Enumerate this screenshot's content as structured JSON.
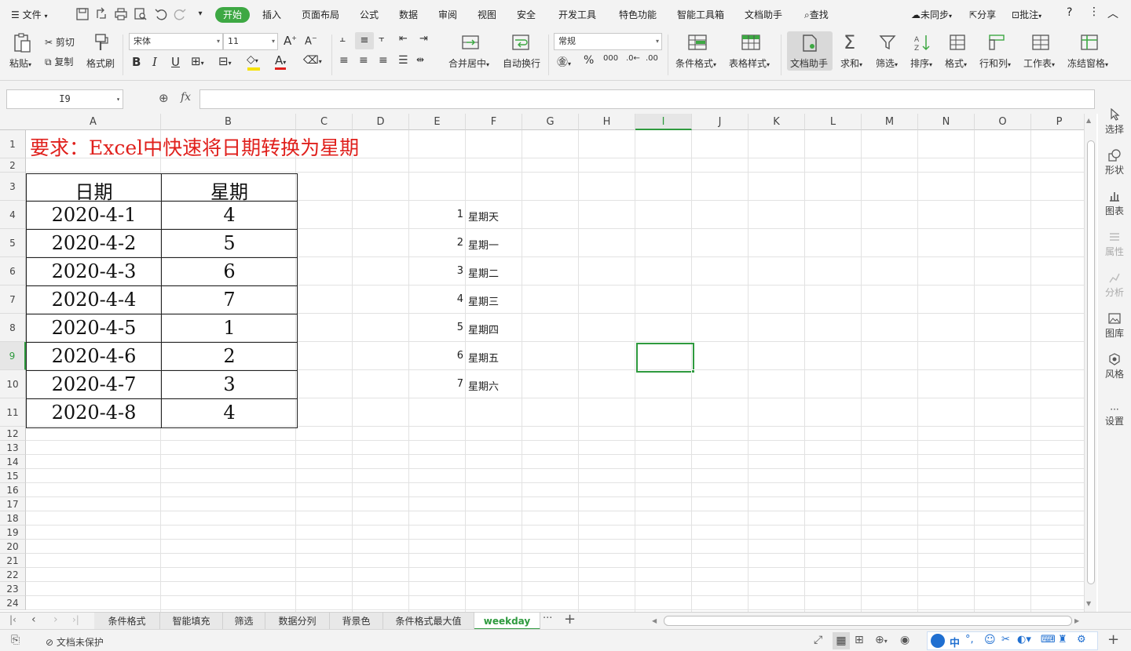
{
  "menubar": {
    "file": "文件",
    "tabs": [
      "开始",
      "插入",
      "页面布局",
      "公式",
      "数据",
      "审阅",
      "视图",
      "安全",
      "开发工具",
      "特色功能",
      "智能工具箱",
      "文档助手"
    ],
    "search": "查找",
    "sync": "未同步",
    "share": "分享",
    "review": "批注"
  },
  "ribbon": {
    "paste": "粘贴",
    "cut": "剪切",
    "copy": "复制",
    "format_painter": "格式刷",
    "font_name": "宋体",
    "font_size": "11",
    "merge_center": "合并居中",
    "wrap_text": "自动换行",
    "number_format": "常规",
    "cond_format": "条件格式",
    "table_style": "表格样式",
    "doc_helper": "文档助手",
    "sum": "求和",
    "filter": "筛选",
    "sort": "排序",
    "format": "格式",
    "row_col": "行和列",
    "worksheet": "工作表",
    "freeze": "冻结窗格"
  },
  "formula_bar": {
    "name_box": "I9",
    "fx": "fx",
    "value": ""
  },
  "columns": [
    "A",
    "B",
    "C",
    "D",
    "E",
    "F",
    "G",
    "H",
    "I",
    "J",
    "K",
    "L",
    "M",
    "N",
    "O",
    "P"
  ],
  "rows": [
    "1",
    "2",
    "3",
    "4",
    "5",
    "6",
    "7",
    "8",
    "9",
    "10",
    "11",
    "12",
    "13",
    "14",
    "15",
    "16",
    "17",
    "18",
    "19",
    "20",
    "21",
    "22",
    "23",
    "24"
  ],
  "sheet": {
    "title": "要求：Excel中快速将日期转换为星期",
    "header_date": "日期",
    "header_week": "星期",
    "table": [
      {
        "date": "2020-4-1",
        "week": "4"
      },
      {
        "date": "2020-4-2",
        "week": "5"
      },
      {
        "date": "2020-4-3",
        "week": "6"
      },
      {
        "date": "2020-4-4",
        "week": "7"
      },
      {
        "date": "2020-4-5",
        "week": "1"
      },
      {
        "date": "2020-4-6",
        "week": "2"
      },
      {
        "date": "2020-4-7",
        "week": "3"
      },
      {
        "date": "2020-4-8",
        "week": "4"
      }
    ],
    "lookup": [
      {
        "num": "1",
        "name": "星期天"
      },
      {
        "num": "2",
        "name": "星期一"
      },
      {
        "num": "3",
        "name": "星期二"
      },
      {
        "num": "4",
        "name": "星期三"
      },
      {
        "num": "5",
        "name": "星期四"
      },
      {
        "num": "6",
        "name": "星期五"
      },
      {
        "num": "7",
        "name": "星期六"
      }
    ]
  },
  "right_panel": [
    "选择",
    "形状",
    "图表",
    "属性",
    "分析",
    "图库",
    "风格",
    "设置"
  ],
  "sheet_tabs": [
    "条件格式",
    "智能填充",
    "筛选",
    "数据分列",
    "背景色",
    "条件格式最大值",
    "weekday"
  ],
  "active_sheet": "weekday",
  "status": {
    "protect": "文档未保护",
    "ime": "中"
  },
  "colors": {
    "accent": "#3da843",
    "title_red": "#e0201c",
    "selection": "#2e9a3e"
  }
}
